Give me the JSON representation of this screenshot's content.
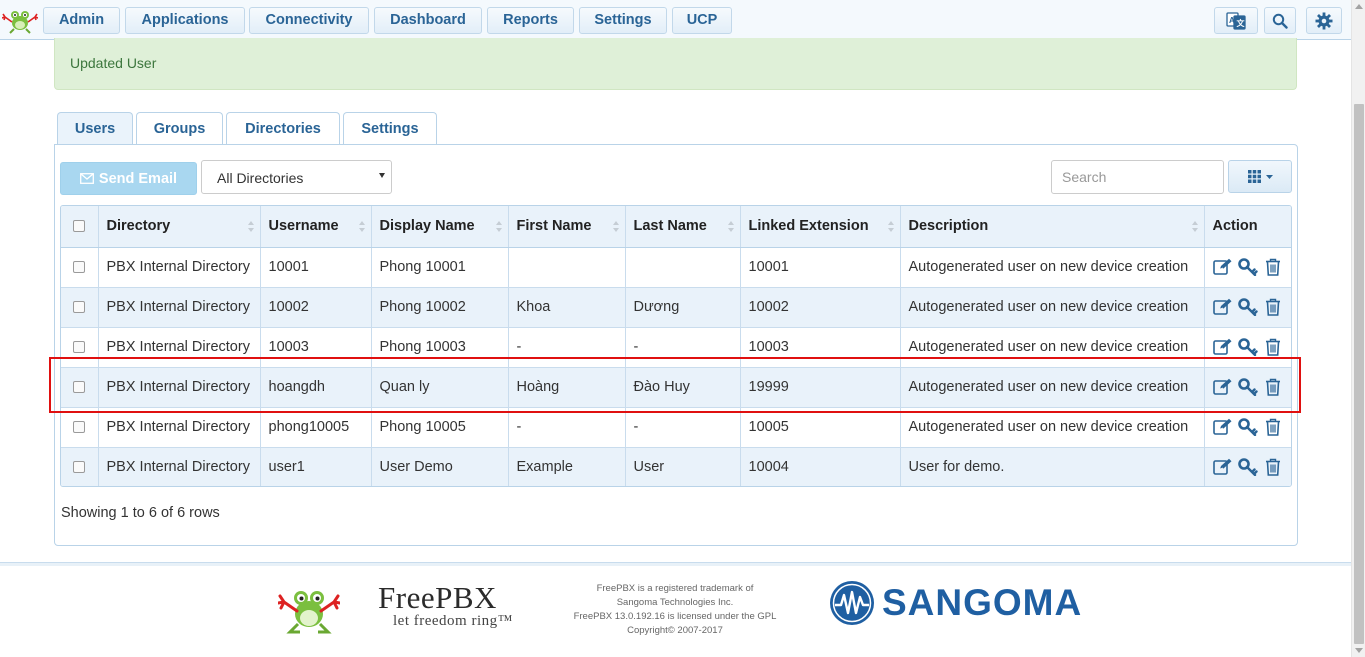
{
  "nav": {
    "items": [
      {
        "label": "Admin"
      },
      {
        "label": "Applications"
      },
      {
        "label": "Connectivity"
      },
      {
        "label": "Dashboard"
      },
      {
        "label": "Reports"
      },
      {
        "label": "Settings"
      },
      {
        "label": "UCP"
      }
    ],
    "icons": [
      "translate-icon",
      "search-icon",
      "gear-icon"
    ]
  },
  "alert": {
    "message": "Updated User"
  },
  "tabs": [
    {
      "label": "Users",
      "active": true
    },
    {
      "label": "Groups"
    },
    {
      "label": "Directories"
    },
    {
      "label": "Settings"
    }
  ],
  "toolbar": {
    "send_email_label": "Send Email",
    "directory_filter": "All Directories",
    "search_placeholder": "Search"
  },
  "table": {
    "columns": [
      "Directory",
      "Username",
      "Display Name",
      "First Name",
      "Last Name",
      "Linked Extension",
      "Description",
      "Action"
    ],
    "rows": [
      {
        "directory": "PBX Internal Directory",
        "username": "10001",
        "display_name": "Phong 10001",
        "first_name": "",
        "last_name": "",
        "extension": "10001",
        "description": "Autogenerated user on new device creation"
      },
      {
        "directory": "PBX Internal Directory",
        "username": "10002",
        "display_name": "Phong 10002",
        "first_name": "Khoa",
        "last_name": "Dương",
        "extension": "10002",
        "description": "Autogenerated user on new device creation"
      },
      {
        "directory": "PBX Internal Directory",
        "username": "10003",
        "display_name": "Phong 10003",
        "first_name": "-",
        "last_name": "-",
        "extension": "10003",
        "description": "Autogenerated user on new device creation"
      },
      {
        "directory": "PBX Internal Directory",
        "username": "hoangdh",
        "display_name": "Quan ly",
        "first_name": "Hoàng",
        "last_name": "Đào Huy",
        "extension": "19999",
        "description": "Autogenerated user on new device creation",
        "highlighted": true
      },
      {
        "directory": "PBX Internal Directory",
        "username": "phong10005",
        "display_name": "Phong 10005",
        "first_name": "-",
        "last_name": "-",
        "extension": "10005",
        "description": "Autogenerated user on new device creation"
      },
      {
        "directory": "PBX Internal Directory",
        "username": "user1",
        "display_name": "User Demo",
        "first_name": "Example",
        "last_name": "User",
        "extension": "10004",
        "description": "User for demo."
      }
    ],
    "action_icons": [
      "edit-icon",
      "key-icon",
      "trash-icon"
    ]
  },
  "pagination": {
    "summary": "Showing 1 to 6 of 6 rows"
  },
  "footer": {
    "brand": "FreePBX",
    "tagline": "let freedom ring™",
    "legal": [
      "FreePBX is a registered trademark of",
      "Sangoma Technologies Inc.",
      "FreePBX 13.0.192.16 is licensed under the GPL",
      "Copyright© 2007-2017"
    ],
    "partner": "SANGOMA"
  },
  "colors": {
    "accent": "#2a6496",
    "header_bg": "#e9f2fa",
    "alert_bg": "#dff0d8",
    "highlight_border": "#e01010"
  }
}
